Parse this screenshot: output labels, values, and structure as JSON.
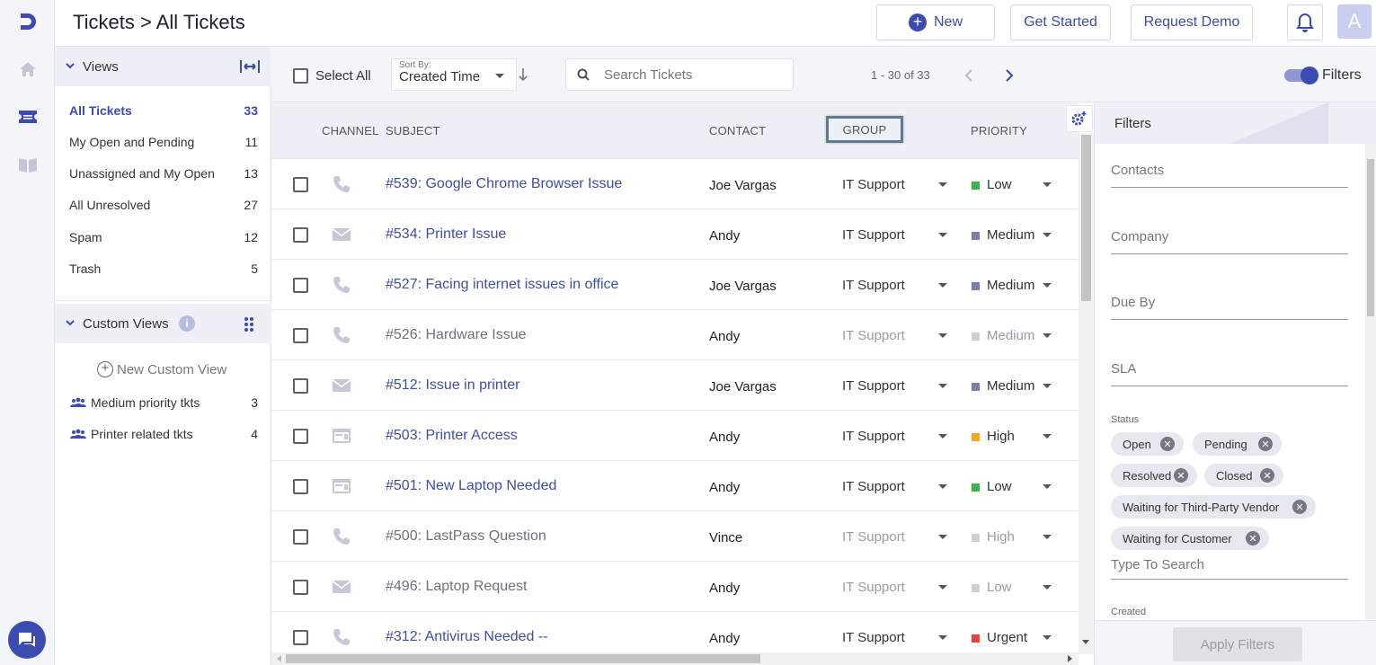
{
  "header": {
    "title": "Tickets > All Tickets",
    "new_label": "New",
    "get_started_label": "Get Started",
    "request_demo_label": "Request Demo",
    "avatar_initial": "A"
  },
  "views": {
    "title": "Views",
    "items": [
      {
        "label": "All Tickets",
        "count": "33"
      },
      {
        "label": "My Open and Pending",
        "count": "11"
      },
      {
        "label": "Unassigned and My Open",
        "count": "13"
      },
      {
        "label": "All Unresolved",
        "count": "27"
      },
      {
        "label": "Spam",
        "count": "12"
      },
      {
        "label": "Trash",
        "count": "5"
      }
    ],
    "custom_title": "Custom Views",
    "new_custom_label": "New Custom View",
    "custom_items": [
      {
        "label": "Medium priority tkts",
        "count": "3"
      },
      {
        "label": "Printer related tkts",
        "count": "4"
      }
    ]
  },
  "toolbar": {
    "select_all": "Select All",
    "sort_by_label": "Sort By:",
    "sort_value": "Created Time",
    "search_placeholder": "Search Tickets",
    "pagination": "1 - 30 of 33",
    "filters_label": "Filters"
  },
  "table": {
    "headers": {
      "channel": "CHANNEL",
      "subject": "SUBJECT",
      "contact": "CONTACT",
      "group": "GROUP",
      "priority": "PRIORITY"
    },
    "rows": [
      {
        "channel": "phone",
        "subject": "#539: Google Chrome Browser Issue",
        "contact": "Joe Vargas",
        "group": "IT Support",
        "priority": "Low",
        "pcolor": "#3cb44b",
        "dim": false
      },
      {
        "channel": "email",
        "subject": "#534: Printer Issue",
        "contact": "Andy",
        "group": "IT Support",
        "priority": "Medium",
        "pcolor": "#7b7fb0",
        "dim": false
      },
      {
        "channel": "phone",
        "subject": "#527: Facing internet issues in office",
        "contact": "Joe Vargas",
        "group": "IT Support",
        "priority": "Medium",
        "pcolor": "#7b7fb0",
        "dim": false
      },
      {
        "channel": "phone",
        "subject": "#526: Hardware Issue",
        "contact": "Andy",
        "group": "IT Support",
        "priority": "Medium",
        "pcolor": "#cfd0d6",
        "dim": true
      },
      {
        "channel": "email",
        "subject": "#512: Issue in printer",
        "contact": "Joe Vargas",
        "group": "IT Support",
        "priority": "Medium",
        "pcolor": "#7b7fb0",
        "dim": false
      },
      {
        "channel": "web",
        "subject": "#503: Printer Access",
        "contact": "Andy",
        "group": "IT Support",
        "priority": "High",
        "pcolor": "#f5a623",
        "dim": false
      },
      {
        "channel": "web",
        "subject": "#501: New Laptop Needed",
        "contact": "Andy",
        "group": "IT Support",
        "priority": "Low",
        "pcolor": "#3cb44b",
        "dim": false
      },
      {
        "channel": "phone",
        "subject": "#500: LastPass Question",
        "contact": "Vince",
        "group": "IT Support",
        "priority": "High",
        "pcolor": "#cfd0d6",
        "dim": true
      },
      {
        "channel": "email",
        "subject": "#496: Laptop Request",
        "contact": "Andy",
        "group": "IT Support",
        "priority": "Low",
        "pcolor": "#cfd0d6",
        "dim": true
      },
      {
        "channel": "phone",
        "subject": "#312: Antivirus Needed --",
        "contact": "Andy",
        "group": "IT Support",
        "priority": "Urgent",
        "pcolor": "#e8453c",
        "dim": false
      }
    ]
  },
  "filters": {
    "title": "Filters",
    "fields": [
      "Contacts",
      "Company",
      "Due By",
      "SLA"
    ],
    "status_label": "Status",
    "status_chips": [
      "Open",
      "Pending",
      "Resolved",
      "Closed",
      "Waiting for Third-Party Vendor",
      "Waiting for Customer"
    ],
    "type_to_search": "Type To Search",
    "created_label": "Created",
    "apply_label": "Apply Filters"
  },
  "colors": {
    "accent": "#3b4bb0",
    "link": "#3d4ea8"
  }
}
